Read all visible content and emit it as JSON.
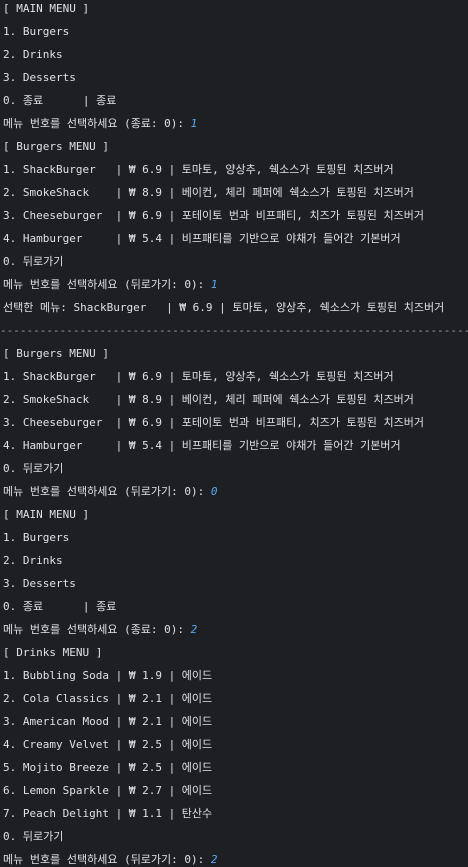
{
  "console": {
    "lines": [
      {
        "text": "[ MAIN MENU ]"
      },
      {
        "text": "1. Burgers"
      },
      {
        "text": "2. Drinks"
      },
      {
        "text": "3. Desserts"
      },
      {
        "text": "0. 종료      | 종료"
      },
      {
        "text": "메뉴 번호를 선택하세요 (종료: 0): ",
        "input": "1"
      },
      {
        "text": "[ Burgers MENU ]"
      },
      {
        "text": "1. ShackBurger   | ₩ 6.9 | 토마토, 양상추, 쉑소스가 토핑된 치즈버거"
      },
      {
        "text": "2. SmokeShack    | ₩ 8.9 | 베이컨, 체리 페퍼에 쉑소스가 토핑된 치즈버거"
      },
      {
        "text": "3. Cheeseburger  | ₩ 6.9 | 포테이토 번과 비프패티, 치즈가 토핑된 치즈버거"
      },
      {
        "text": "4. Hamburger     | ₩ 5.4 | 비프패티를 기반으로 야채가 들어간 기본버거"
      },
      {
        "text": "0. 뒤로가기"
      },
      {
        "text": "메뉴 번호를 선택하세요 (뒤로가기: 0): ",
        "input": "1"
      },
      {
        "text": "선택한 메뉴: ShackBurger   | ₩ 6.9 | 토마토, 양상추, 쉑소스가 토핑된 치즈버거"
      },
      {
        "text": "------------------------------------------------------------------------",
        "separator": true
      },
      {
        "text": "[ Burgers MENU ]"
      },
      {
        "text": "1. ShackBurger   | ₩ 6.9 | 토마토, 양상추, 쉑소스가 토핑된 치즈버거"
      },
      {
        "text": "2. SmokeShack    | ₩ 8.9 | 베이컨, 체리 페퍼에 쉑소스가 토핑된 치즈버거"
      },
      {
        "text": "3. Cheeseburger  | ₩ 6.9 | 포테이토 번과 비프패티, 치즈가 토핑된 치즈버거"
      },
      {
        "text": "4. Hamburger     | ₩ 5.4 | 비프패티를 기반으로 야채가 들어간 기본버거"
      },
      {
        "text": "0. 뒤로가기"
      },
      {
        "text": "메뉴 번호를 선택하세요 (뒤로가기: 0): ",
        "input": "0"
      },
      {
        "text": "[ MAIN MENU ]"
      },
      {
        "text": "1. Burgers"
      },
      {
        "text": "2. Drinks"
      },
      {
        "text": "3. Desserts"
      },
      {
        "text": "0. 종료      | 종료"
      },
      {
        "text": "메뉴 번호를 선택하세요 (종료: 0): ",
        "input": "2"
      },
      {
        "text": "[ Drinks MENU ]"
      },
      {
        "text": "1. Bubbling Soda | ₩ 1.9 | 에이드"
      },
      {
        "text": "2. Cola Classics | ₩ 2.1 | 에이드"
      },
      {
        "text": "3. American Mood | ₩ 2.1 | 에이드"
      },
      {
        "text": "4. Creamy Velvet | ₩ 2.5 | 에이드"
      },
      {
        "text": "5. Mojito Breeze | ₩ 2.5 | 에이드"
      },
      {
        "text": "6. Lemon Sparkle | ₩ 2.7 | 에이드"
      },
      {
        "text": "7. Peach Delight | ₩ 1.1 | 탄산수"
      },
      {
        "text": "0. 뒤로가기"
      },
      {
        "text": "메뉴 번호를 선택하세요 (뒤로가기: 0): ",
        "input": "2"
      }
    ]
  },
  "colors": {
    "background": "#1e1f22",
    "text": "#dfe1e5",
    "user_input": "#56a8f5",
    "separator": "#9da0a8"
  }
}
